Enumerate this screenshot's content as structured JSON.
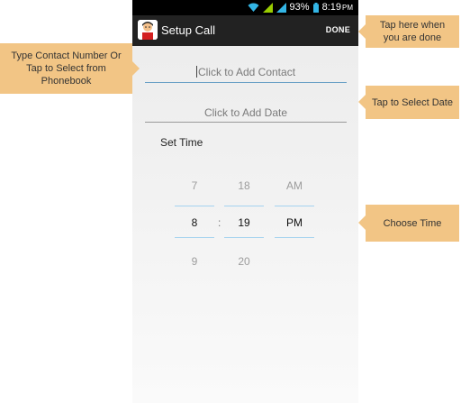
{
  "status_bar": {
    "battery_percent": "93%",
    "time": "8:19",
    "ampm": "PM"
  },
  "action_bar": {
    "title": "Setup Call",
    "done_label": "DONE"
  },
  "form": {
    "contact_placeholder": "Click to Add Contact",
    "date_placeholder": "Click to Add Date",
    "set_time_label": "Set Time"
  },
  "time_picker": {
    "hour_prev": "7",
    "hour": "8",
    "hour_next": "9",
    "minute_prev": "18",
    "minute": "19",
    "minute_next": "20",
    "ampm_prev": "AM",
    "ampm": "PM",
    "separator": ":"
  },
  "callouts": {
    "done": "Tap here when you are done",
    "contact": "Type Contact Number Or Tap to Select from Phonebook",
    "date": "Tap to Select Date",
    "time": "Choose Time"
  },
  "colors": {
    "callout_bg": "#f2c585",
    "accent_line": "#a5d3ef",
    "action_bar": "#222222"
  }
}
